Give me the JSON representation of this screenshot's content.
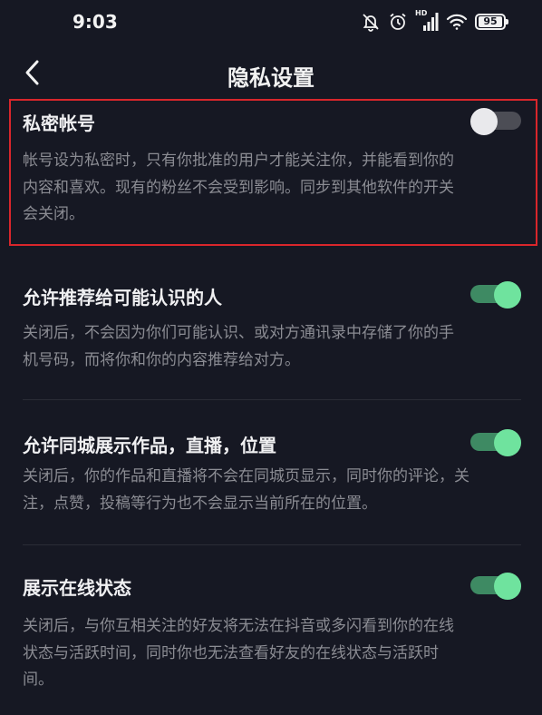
{
  "status_bar": {
    "time": "9:03",
    "icons": [
      "mute-icon",
      "alarm-icon",
      "hd-signal-icon",
      "wifi-icon",
      "battery-icon"
    ],
    "network_label": "HD",
    "battery": "95"
  },
  "header": {
    "title": "隐私设置",
    "back_icon": "chevron-left-icon"
  },
  "settings": [
    {
      "title": "私密帐号",
      "description_lines": [
        "帐号设为私密时，只有你批准的用户才能关注你，并能看到你的",
        "内容和喜欢。现有的粉丝不会受到影响。同步到其他软件的开关",
        "会关闭。"
      ],
      "enabled": false,
      "highlighted": true
    },
    {
      "title": "允许推荐给可能认识的人",
      "description_lines": [
        "关闭后，不会因为你们可能认识、或对方通讯录中存储了你的手",
        "机号码，而将你和你的内容推荐给对方。"
      ],
      "enabled": true
    },
    {
      "title": "允许同城展示作品，直播，位置",
      "description_lines": [
        "关闭后，你的作品和直播将不会在同城页显示，同时你的评论，关",
        "注，点赞，投稿等行为也不会显示当前所在的位置。"
      ],
      "enabled": true
    },
    {
      "title": "展示在线状态",
      "description_lines": [
        "关闭后，与你互相关注的好友将无法在抖音或多闪看到你的在线",
        "状态与活跃时间，同时你也无法查看好友的在线状态与活跃时",
        "间。"
      ],
      "enabled": true
    }
  ],
  "colors": {
    "background": "#161823",
    "toggle_on_track": "#3e8a63",
    "toggle_on_knob": "#6fe39e",
    "toggle_off_track": "#4c4d55",
    "highlight_border": "#d9262b"
  }
}
